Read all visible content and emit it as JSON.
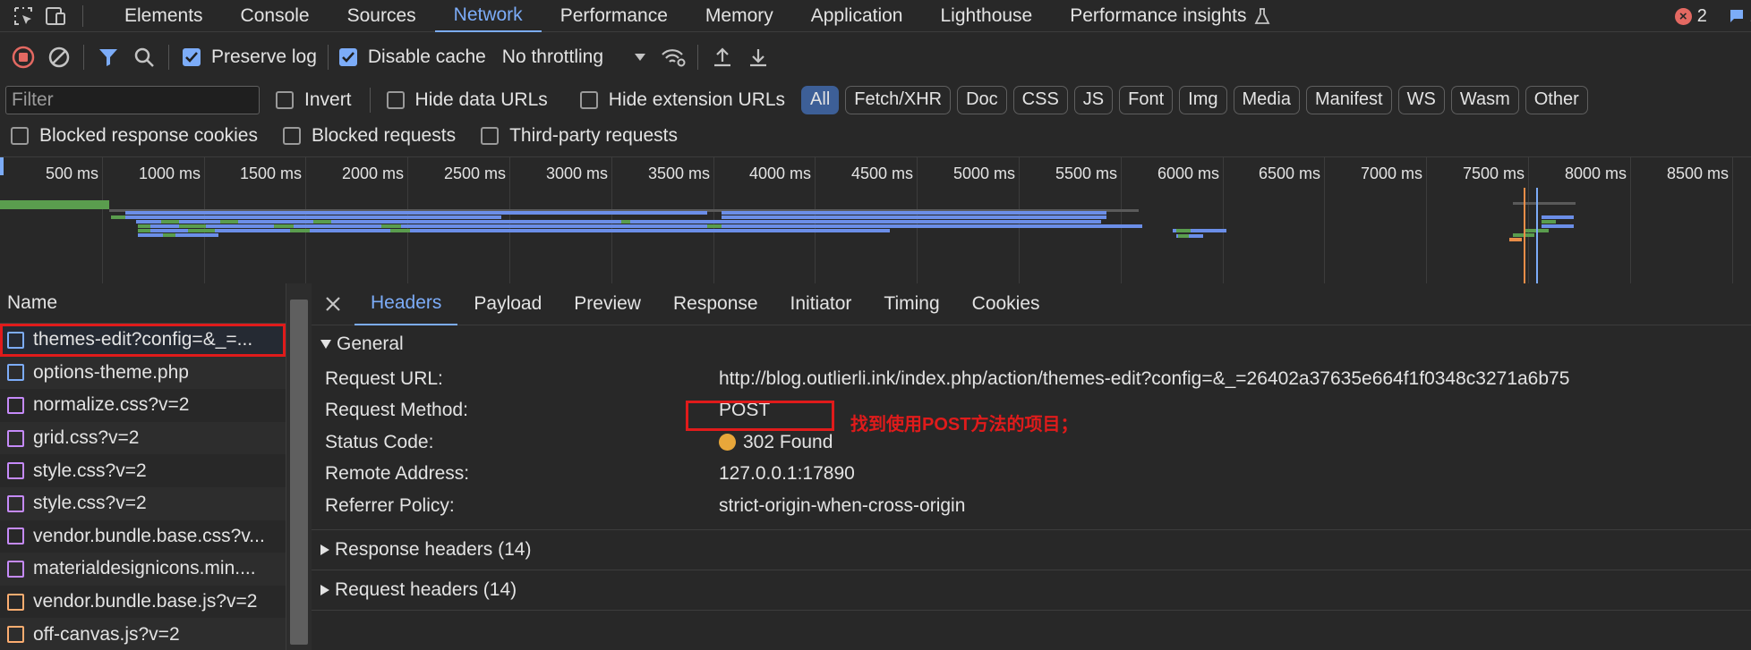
{
  "main_tabs": [
    {
      "label": "Elements"
    },
    {
      "label": "Console"
    },
    {
      "label": "Sources"
    },
    {
      "label": "Network"
    },
    {
      "label": "Performance"
    },
    {
      "label": "Memory"
    },
    {
      "label": "Application"
    },
    {
      "label": "Lighthouse"
    },
    {
      "label": "Performance insights"
    }
  ],
  "issues": {
    "errors": "2",
    "messages": "2"
  },
  "toolbar": {
    "preserve_log": "Preserve log",
    "disable_cache": "Disable cache",
    "throttling": "No throttling"
  },
  "filter": {
    "placeholder": "Filter",
    "invert": "Invert",
    "hide_data_urls": "Hide data URLs",
    "hide_extension_urls": "Hide extension URLs",
    "types": [
      "All",
      "Fetch/XHR",
      "Doc",
      "CSS",
      "JS",
      "Font",
      "Img",
      "Media",
      "Manifest",
      "WS",
      "Wasm",
      "Other"
    ]
  },
  "checks": {
    "blocked_cookies": "Blocked response cookies",
    "blocked_requests": "Blocked requests",
    "third_party": "Third-party requests"
  },
  "timeline": {
    "ticks": [
      "500 ms",
      "1000 ms",
      "1500 ms",
      "2000 ms",
      "2500 ms",
      "3000 ms",
      "3500 ms",
      "4000 ms",
      "4500 ms",
      "5000 ms",
      "5500 ms",
      "6000 ms",
      "6500 ms",
      "7000 ms",
      "7500 ms",
      "8000 ms",
      "8500 ms"
    ]
  },
  "requests": {
    "header": "Name",
    "rows": [
      {
        "name": "themes-edit?config=&_=...",
        "type": "doc"
      },
      {
        "name": "options-theme.php",
        "type": "doc"
      },
      {
        "name": "normalize.css?v=2",
        "type": "css"
      },
      {
        "name": "grid.css?v=2",
        "type": "css"
      },
      {
        "name": "style.css?v=2",
        "type": "css"
      },
      {
        "name": "style.css?v=2",
        "type": "css"
      },
      {
        "name": "vendor.bundle.base.css?v...",
        "type": "css"
      },
      {
        "name": "materialdesignicons.min....",
        "type": "css"
      },
      {
        "name": "vendor.bundle.base.js?v=2",
        "type": "js"
      },
      {
        "name": "off-canvas.js?v=2",
        "type": "js"
      }
    ]
  },
  "details": {
    "tabs": [
      "Headers",
      "Payload",
      "Preview",
      "Response",
      "Initiator",
      "Timing",
      "Cookies"
    ],
    "general_title": "General",
    "general": {
      "request_url_label": "Request URL:",
      "request_url": "http://blog.outlierli.ink/index.php/action/themes-edit?config=&_=26402a37635e664f1f0348c3271a6b75",
      "method_label": "Request Method:",
      "method": "POST",
      "status_label": "Status Code:",
      "status": "302 Found",
      "remote_label": "Remote Address:",
      "remote": "127.0.0.1:17890",
      "referrer_label": "Referrer Policy:",
      "referrer": "strict-origin-when-cross-origin"
    },
    "response_headers": "Response headers (14)",
    "request_headers": "Request headers (14)"
  },
  "annotation": "找到使用POST方法的项目；",
  "colors": {
    "accent": "#7cacf8",
    "highlight": "#e01b1b",
    "status_redirect": "#e8a73a"
  }
}
